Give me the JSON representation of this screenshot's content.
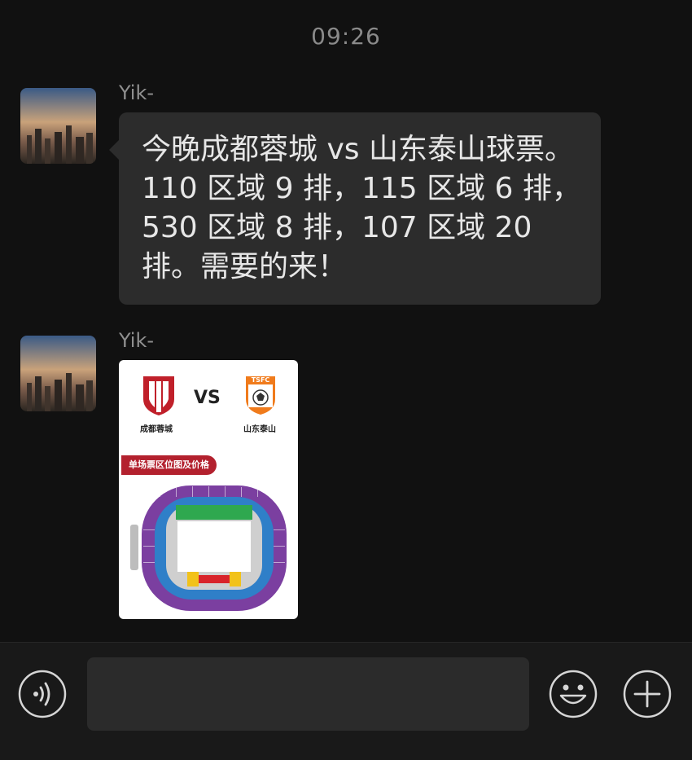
{
  "header": {
    "time": "09:26"
  },
  "messages": [
    {
      "sender": "Yik-",
      "type": "text",
      "text": "今晚成都蓉城 vs 山东泰山球票。110 区域 9 排，115 区域 6 排，530 区域 8 排，107 区域 20 排。需要的来！"
    },
    {
      "sender": "Yik-",
      "type": "image",
      "image": {
        "vs": "VS",
        "home_team": "成都蓉城",
        "away_team": "山东泰山",
        "away_logo_text": "TSFC",
        "banner": "单场票区位图及价格"
      }
    }
  ],
  "input_bar": {
    "voice_icon": "voice-icon",
    "emoji_icon": "emoji-icon",
    "plus_icon": "plus-icon",
    "input_value": ""
  },
  "colors": {
    "background": "#111111",
    "bubble": "#2c2c2c",
    "purple_section": "#7b3fa0",
    "blue_section": "#2f7fc8",
    "green_section": "#2fa84f",
    "yellow_section": "#f2c21a",
    "red_section": "#d8232a"
  }
}
